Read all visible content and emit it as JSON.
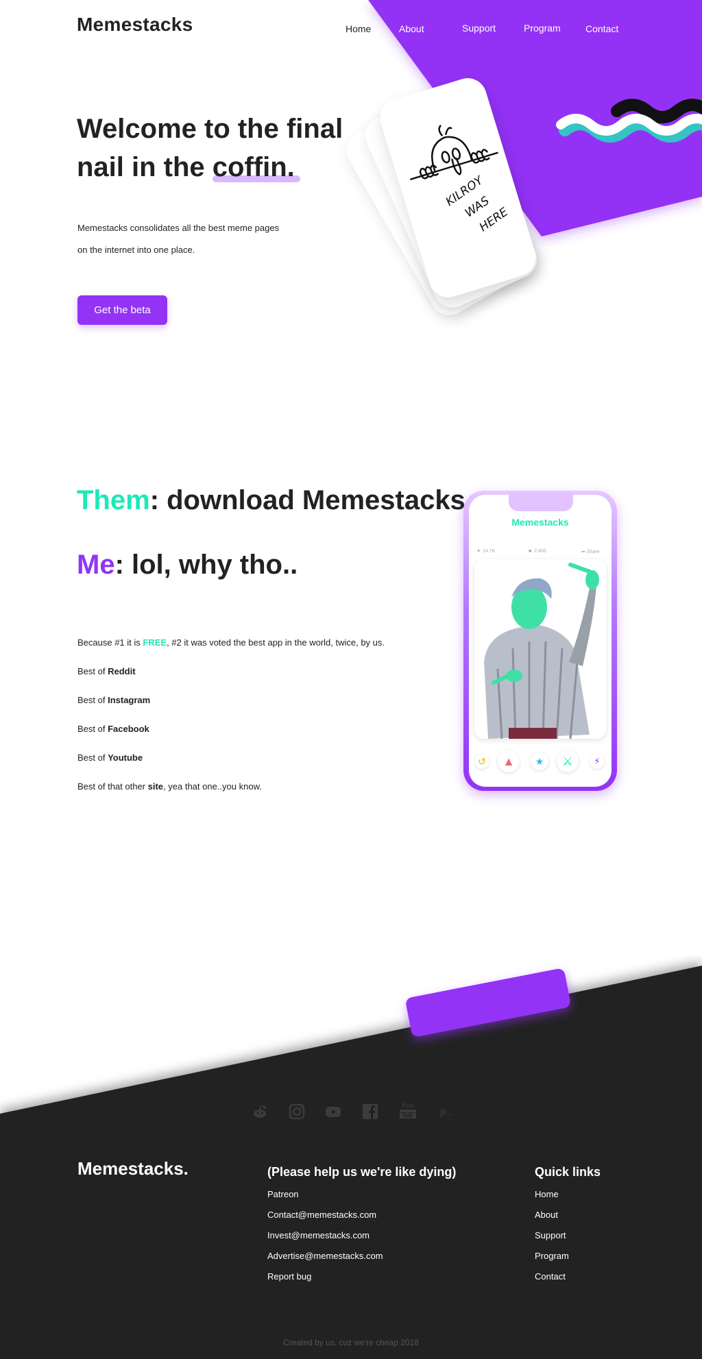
{
  "brand": "Memestacks",
  "colors": {
    "purple": "#9333f5",
    "teal": "#1de9b6",
    "dark": "#202020",
    "text": "#222222"
  },
  "nav": [
    {
      "label": "Home"
    },
    {
      "label": "About"
    },
    {
      "label": "Support"
    },
    {
      "label": "Program"
    },
    {
      "label": "Contact"
    }
  ],
  "hero": {
    "title_line1": "Welcome to the final",
    "title_line2_prefix": "nail in the ",
    "title_highlight": "coffin.",
    "desc_line1": "Memestacks consolidates all the best meme pages",
    "desc_line2": "on the internet into one place.",
    "cta": "Get the beta",
    "card_text": [
      "KILROY",
      "WAS",
      "HERE"
    ]
  },
  "section2": {
    "them": "Them",
    "them_rest": ": download Memestacks",
    "me": "Me",
    "me_rest": ": lol, why tho..",
    "reason_prefix": "Because #1 it is ",
    "reason_free": "FREE",
    "reason_suffix": ",  #2 it was voted the best app in the world, twice, by us.",
    "best_of_prefix": "Best of ",
    "best_of": [
      "Reddit",
      "Instagram",
      "Facebook",
      "Youtube"
    ],
    "last_prefix": "Best of that other ",
    "last_bold": "site",
    "last_suffix": ", yea that one..you know."
  },
  "phone": {
    "app_name": "Memestacks",
    "likes": "14.7K",
    "comments": "2,400",
    "share": "Share",
    "actions": [
      "undo-icon",
      "poop-icon",
      "star-icon",
      "trophy-icon",
      "bolt-icon"
    ]
  },
  "social_icons": [
    "reddit-icon",
    "instagram-icon",
    "youtube-icon",
    "facebook-icon",
    "pornhub-icon",
    "jk-icon"
  ],
  "social_labels": {
    "pornhub_top": "Porn",
    "pornhub_bottom": "hub",
    "jk": "jk.."
  },
  "footer": {
    "logo": "Memestacks.",
    "help_heading": "(Please help us we're like dying)",
    "help_links": [
      "Patreon",
      "Contact@memestacks.com",
      "Invest@memestacks.com",
      "Advertise@memestacks.com",
      "Report bug"
    ],
    "quick_heading": "Quick links",
    "quick_links": [
      "Home",
      "About",
      "Support",
      "Program",
      "Contact"
    ],
    "copyright": "Created by us, cuz we're cheap 2018"
  }
}
